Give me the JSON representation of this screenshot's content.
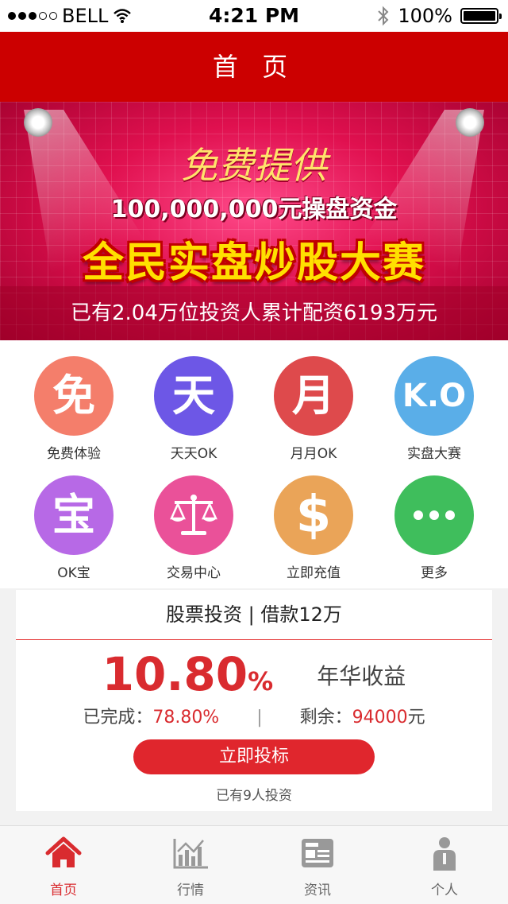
{
  "status_bar": {
    "carrier": "BELL",
    "time": "4:21 PM",
    "battery": "100%"
  },
  "header": {
    "title": "首 页"
  },
  "banner": {
    "line1": "免费提供",
    "line2": "100,000,000元操盘资金",
    "line3": "全民实盘炒股大赛",
    "summary": "已有2.04万位投资人累计配资6193万元"
  },
  "menu": {
    "items": [
      {
        "label": "免费体验",
        "glyph": "免",
        "color": "#f47e6b"
      },
      {
        "label": "天天OK",
        "glyph": "天",
        "color": "#6d57e6"
      },
      {
        "label": "月月OK",
        "glyph": "月",
        "color": "#de4a4c"
      },
      {
        "label": "实盘大赛",
        "glyph": "K.O",
        "color": "#5aaee8"
      },
      {
        "label": "OK宝",
        "glyph": "宝",
        "color": "#b769e6"
      },
      {
        "label": "交易中心",
        "glyph": "scale-icon",
        "color": "#ea5199"
      },
      {
        "label": "立即充值",
        "glyph": "$",
        "color": "#eaa458"
      },
      {
        "label": "更多",
        "glyph": "more-icon",
        "color": "#3fbe5c"
      }
    ]
  },
  "product": {
    "title": "股票投资 | 借款12万",
    "rate_value": "10.80",
    "rate_unit": "%",
    "rate_label": "年华收益",
    "completed_label": "已完成：",
    "completed_value": "78.80%",
    "separator": "|",
    "remaining_label": "剩余：",
    "remaining_value": "94000",
    "remaining_unit": "元",
    "button_label": "立即投标",
    "investors_text": "已有9人投资"
  },
  "tabbar": {
    "tabs": [
      {
        "label": "首页",
        "icon": "home-icon",
        "active": true
      },
      {
        "label": "行情",
        "icon": "chart-icon",
        "active": false
      },
      {
        "label": "资讯",
        "icon": "news-icon",
        "active": false
      },
      {
        "label": "个人",
        "icon": "person-icon",
        "active": false
      }
    ]
  },
  "colors": {
    "brand_red": "#cc0000",
    "accent_red": "#d92b2f"
  }
}
